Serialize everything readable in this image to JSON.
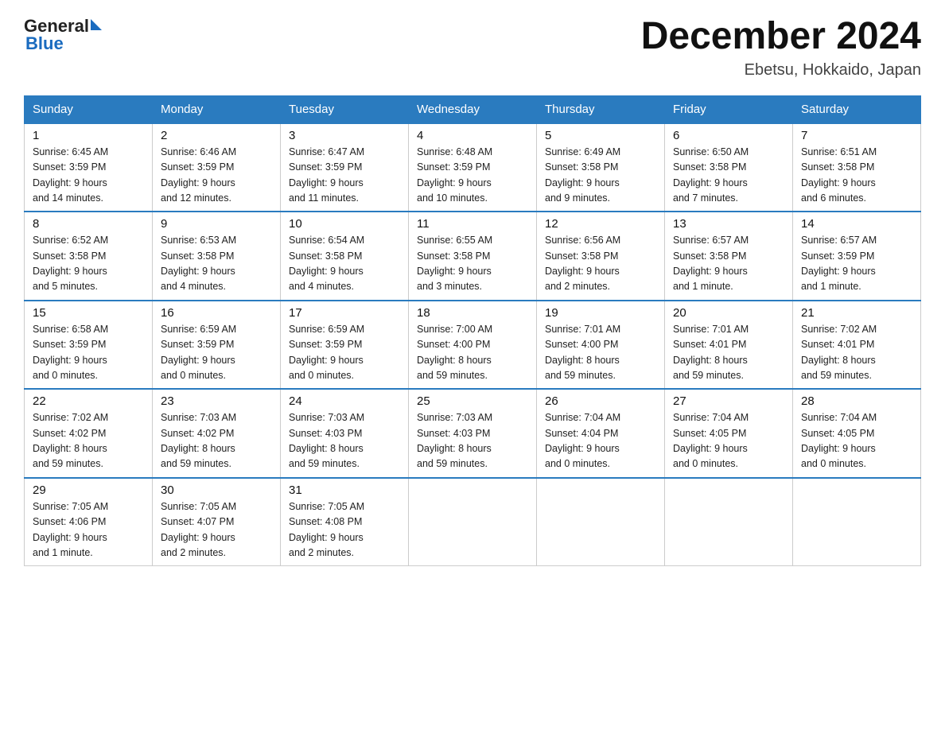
{
  "header": {
    "logo_general": "General",
    "logo_blue": "Blue",
    "month_title": "December 2024",
    "location": "Ebetsu, Hokkaido, Japan"
  },
  "days_of_week": [
    "Sunday",
    "Monday",
    "Tuesday",
    "Wednesday",
    "Thursday",
    "Friday",
    "Saturday"
  ],
  "weeks": [
    [
      {
        "day": "1",
        "sunrise": "6:45 AM",
        "sunset": "3:59 PM",
        "daylight": "9 hours and 14 minutes."
      },
      {
        "day": "2",
        "sunrise": "6:46 AM",
        "sunset": "3:59 PM",
        "daylight": "9 hours and 12 minutes."
      },
      {
        "day": "3",
        "sunrise": "6:47 AM",
        "sunset": "3:59 PM",
        "daylight": "9 hours and 11 minutes."
      },
      {
        "day": "4",
        "sunrise": "6:48 AM",
        "sunset": "3:59 PM",
        "daylight": "9 hours and 10 minutes."
      },
      {
        "day": "5",
        "sunrise": "6:49 AM",
        "sunset": "3:58 PM",
        "daylight": "9 hours and 9 minutes."
      },
      {
        "day": "6",
        "sunrise": "6:50 AM",
        "sunset": "3:58 PM",
        "daylight": "9 hours and 7 minutes."
      },
      {
        "day": "7",
        "sunrise": "6:51 AM",
        "sunset": "3:58 PM",
        "daylight": "9 hours and 6 minutes."
      }
    ],
    [
      {
        "day": "8",
        "sunrise": "6:52 AM",
        "sunset": "3:58 PM",
        "daylight": "9 hours and 5 minutes."
      },
      {
        "day": "9",
        "sunrise": "6:53 AM",
        "sunset": "3:58 PM",
        "daylight": "9 hours and 4 minutes."
      },
      {
        "day": "10",
        "sunrise": "6:54 AM",
        "sunset": "3:58 PM",
        "daylight": "9 hours and 4 minutes."
      },
      {
        "day": "11",
        "sunrise": "6:55 AM",
        "sunset": "3:58 PM",
        "daylight": "9 hours and 3 minutes."
      },
      {
        "day": "12",
        "sunrise": "6:56 AM",
        "sunset": "3:58 PM",
        "daylight": "9 hours and 2 minutes."
      },
      {
        "day": "13",
        "sunrise": "6:57 AM",
        "sunset": "3:58 PM",
        "daylight": "9 hours and 1 minute."
      },
      {
        "day": "14",
        "sunrise": "6:57 AM",
        "sunset": "3:59 PM",
        "daylight": "9 hours and 1 minute."
      }
    ],
    [
      {
        "day": "15",
        "sunrise": "6:58 AM",
        "sunset": "3:59 PM",
        "daylight": "9 hours and 0 minutes."
      },
      {
        "day": "16",
        "sunrise": "6:59 AM",
        "sunset": "3:59 PM",
        "daylight": "9 hours and 0 minutes."
      },
      {
        "day": "17",
        "sunrise": "6:59 AM",
        "sunset": "3:59 PM",
        "daylight": "9 hours and 0 minutes."
      },
      {
        "day": "18",
        "sunrise": "7:00 AM",
        "sunset": "4:00 PM",
        "daylight": "8 hours and 59 minutes."
      },
      {
        "day": "19",
        "sunrise": "7:01 AM",
        "sunset": "4:00 PM",
        "daylight": "8 hours and 59 minutes."
      },
      {
        "day": "20",
        "sunrise": "7:01 AM",
        "sunset": "4:01 PM",
        "daylight": "8 hours and 59 minutes."
      },
      {
        "day": "21",
        "sunrise": "7:02 AM",
        "sunset": "4:01 PM",
        "daylight": "8 hours and 59 minutes."
      }
    ],
    [
      {
        "day": "22",
        "sunrise": "7:02 AM",
        "sunset": "4:02 PM",
        "daylight": "8 hours and 59 minutes."
      },
      {
        "day": "23",
        "sunrise": "7:03 AM",
        "sunset": "4:02 PM",
        "daylight": "8 hours and 59 minutes."
      },
      {
        "day": "24",
        "sunrise": "7:03 AM",
        "sunset": "4:03 PM",
        "daylight": "8 hours and 59 minutes."
      },
      {
        "day": "25",
        "sunrise": "7:03 AM",
        "sunset": "4:03 PM",
        "daylight": "8 hours and 59 minutes."
      },
      {
        "day": "26",
        "sunrise": "7:04 AM",
        "sunset": "4:04 PM",
        "daylight": "9 hours and 0 minutes."
      },
      {
        "day": "27",
        "sunrise": "7:04 AM",
        "sunset": "4:05 PM",
        "daylight": "9 hours and 0 minutes."
      },
      {
        "day": "28",
        "sunrise": "7:04 AM",
        "sunset": "4:05 PM",
        "daylight": "9 hours and 0 minutes."
      }
    ],
    [
      {
        "day": "29",
        "sunrise": "7:05 AM",
        "sunset": "4:06 PM",
        "daylight": "9 hours and 1 minute."
      },
      {
        "day": "30",
        "sunrise": "7:05 AM",
        "sunset": "4:07 PM",
        "daylight": "9 hours and 2 minutes."
      },
      {
        "day": "31",
        "sunrise": "7:05 AM",
        "sunset": "4:08 PM",
        "daylight": "9 hours and 2 minutes."
      },
      null,
      null,
      null,
      null
    ]
  ],
  "labels": {
    "sunrise": "Sunrise:",
    "sunset": "Sunset:",
    "daylight": "Daylight:"
  }
}
